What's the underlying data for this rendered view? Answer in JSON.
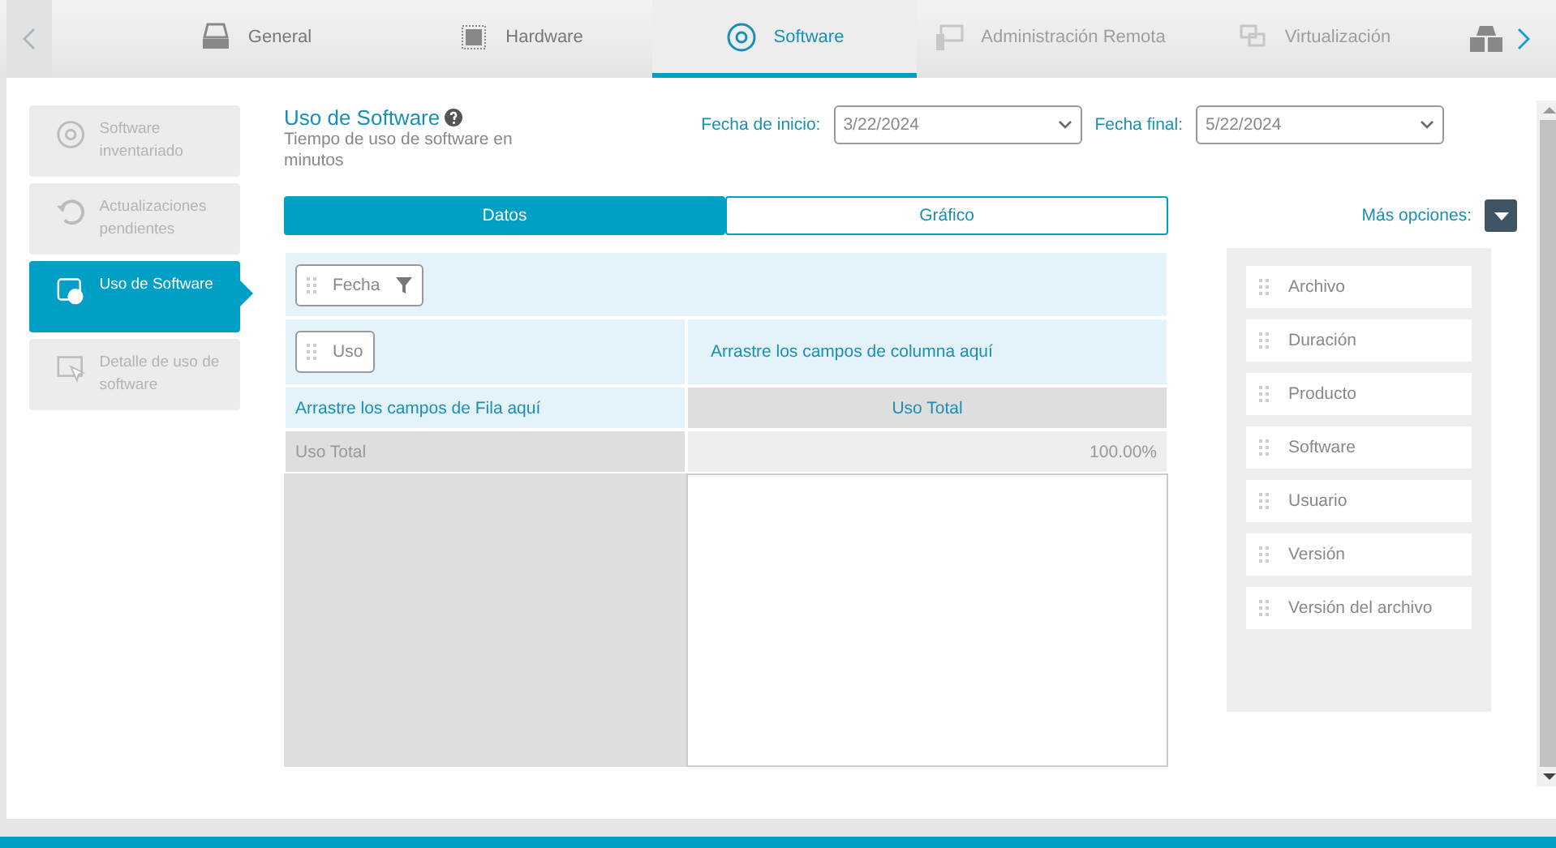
{
  "tabs": [
    {
      "label": "General",
      "selected": false,
      "disabled": false
    },
    {
      "label": "Hardware",
      "selected": false,
      "disabled": false
    },
    {
      "label": "Software",
      "selected": true,
      "disabled": false
    },
    {
      "label": "Administración Remota",
      "selected": false,
      "disabled": true
    },
    {
      "label": "Virtualización",
      "selected": false,
      "disabled": true
    }
  ],
  "sidebar": {
    "items": [
      {
        "label": "Software inventariado",
        "selected": false
      },
      {
        "label": "Actualizaciones pendientes",
        "selected": false
      },
      {
        "label": "Uso de Software",
        "selected": true
      },
      {
        "label": "Detalle de uso de software",
        "selected": false
      }
    ]
  },
  "header": {
    "title": "Uso de Software",
    "subtitle": "Tiempo de uso de software en minutos"
  },
  "dates": [
    {
      "label": "Fecha de inicio:",
      "value": "3/22/2024"
    },
    {
      "label": "Fecha final:",
      "value": "5/22/2024"
    }
  ],
  "more_options": "Más opciones:",
  "view_tabs": [
    {
      "label": "Datos",
      "selected": true
    },
    {
      "label": "Gráfico",
      "selected": false
    }
  ],
  "pivot": {
    "filter_field": "Fecha",
    "data_field": "Uso",
    "column_hint": "Arrastre los campos de columna aquí",
    "row_hint": "Arrastre los campos de Fila aquí",
    "column_header": "Uso Total",
    "row_header": "Uso Total",
    "value": "100.00%"
  },
  "fields": [
    "Archivo",
    "Duración",
    "Producto",
    "Software",
    "Usuario",
    "Versión",
    "Versión del archivo"
  ]
}
